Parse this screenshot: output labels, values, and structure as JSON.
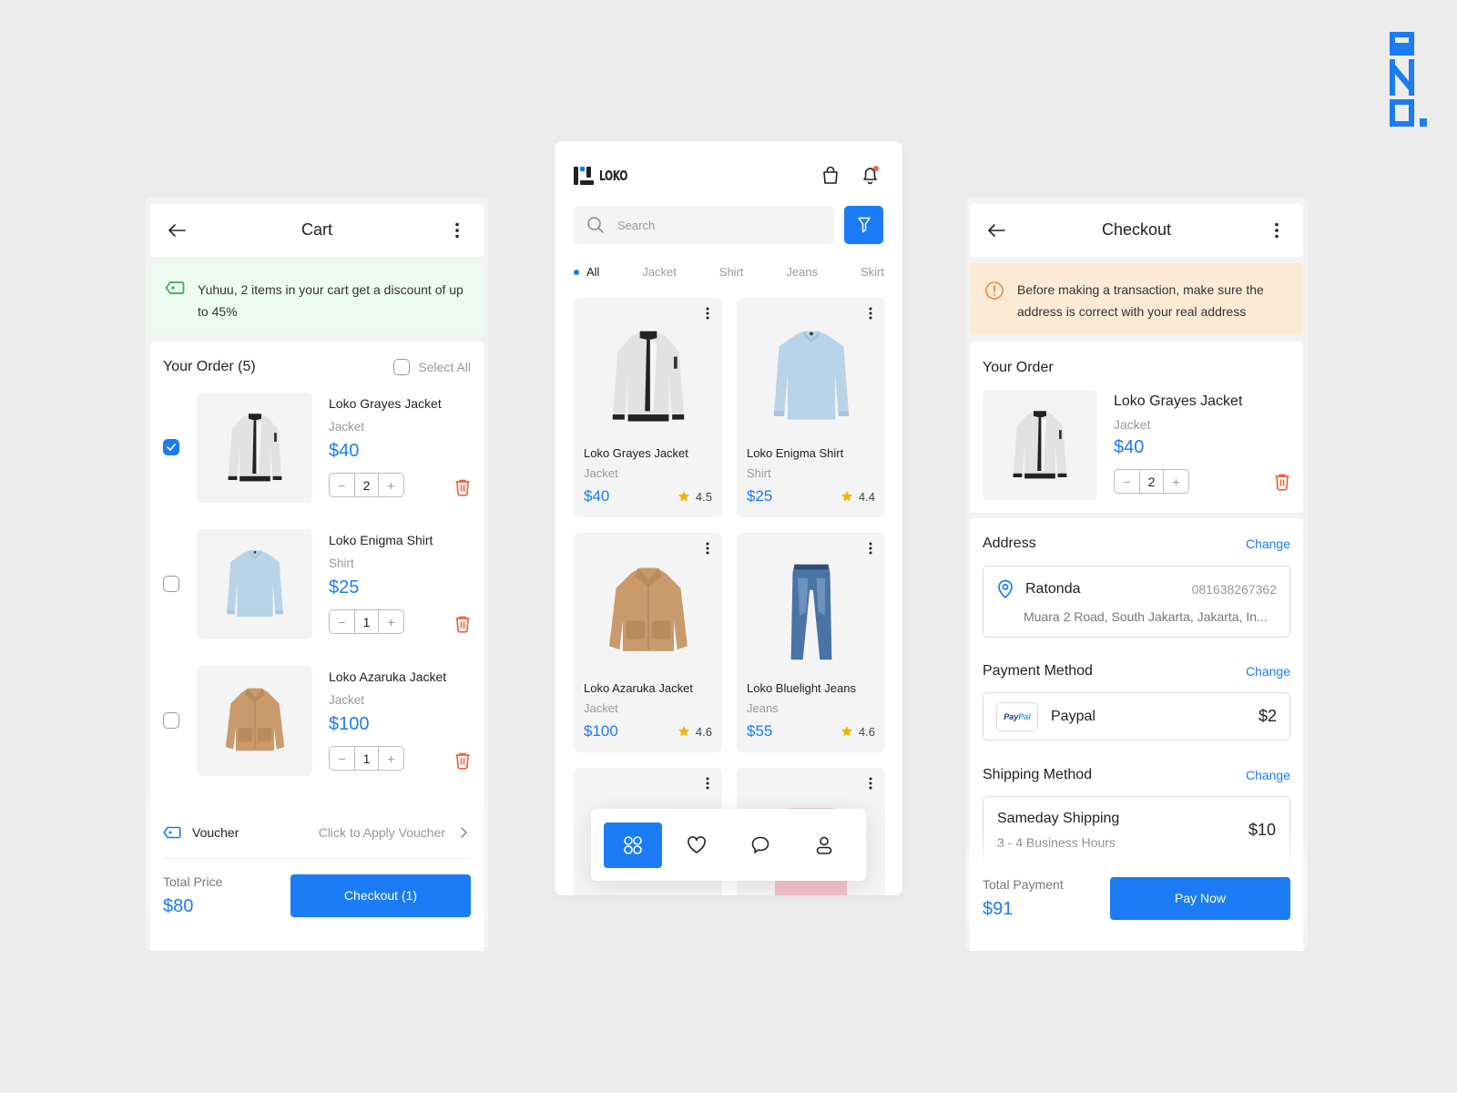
{
  "colors": {
    "accent": "#1b7cf5",
    "danger": "#f0623a",
    "success_bg": "#eefbf2",
    "success_icon": "#3aa65a",
    "warning_bg": "#fdebd6",
    "warning_icon": "#f08a3a",
    "rating_star": "#f5b400",
    "background": "#ececec"
  },
  "brand_mark": "ANO.",
  "cart": {
    "title": "Cart",
    "banner": "Yuhuu, 2 items in your cart get a discount of up to 45%",
    "order_title": "Your Order (5)",
    "select_all": "Select All",
    "items": [
      {
        "name": "Loko Grayes Jacket",
        "category": "Jacket",
        "price": "$40",
        "qty": "2",
        "selected": true,
        "image": "white-jacket"
      },
      {
        "name": "Loko Enigma Shirt",
        "category": "Shirt",
        "price": "$25",
        "qty": "1",
        "selected": false,
        "image": "blue-shirt"
      },
      {
        "name": "Loko Azaruka Jacket",
        "category": "Jacket",
        "price": "$100",
        "qty": "1",
        "selected": false,
        "image": "teddy-jacket"
      }
    ],
    "voucher_label": "Voucher",
    "voucher_hint": "Click to Apply Voucher",
    "total_label": "Total Price",
    "total_value": "$80",
    "checkout_button": "Checkout (1)"
  },
  "home": {
    "logo_text": "LOKO",
    "search_placeholder": "Search",
    "categories": [
      "All",
      "Jacket",
      "Shirt",
      "Jeans",
      "Skirt"
    ],
    "active_category": "All",
    "products": [
      {
        "name": "Loko Grayes Jacket",
        "category": "Jacket",
        "price": "$40",
        "rating": "4.5",
        "image": "white-jacket"
      },
      {
        "name": "Loko Enigma Shirt",
        "category": "Shirt",
        "price": "$25",
        "rating": "4.4",
        "image": "blue-shirt"
      },
      {
        "name": "Loko Azaruka Jacket",
        "category": "Jacket",
        "price": "$100",
        "rating": "4.6",
        "image": "teddy-jacket"
      },
      {
        "name": "Loko Bluelight Jeans",
        "category": "Jeans",
        "price": "$55",
        "rating": "4.6",
        "image": "jeans"
      }
    ],
    "nav": [
      "home",
      "favorites",
      "messages",
      "profile"
    ],
    "active_nav": "home"
  },
  "checkout": {
    "title": "Checkout",
    "banner": "Before making a transaction, make sure the address is correct with your real address",
    "order_title": "Your Order",
    "item": {
      "name": "Loko Grayes Jacket",
      "category": "Jacket",
      "price": "$40",
      "qty": "2"
    },
    "address_label": "Address",
    "change_label": "Change",
    "address": {
      "name": "Ratonda",
      "phone": "081638267362",
      "line": "Muara 2 Road, South Jakarta, Jakarta, In..."
    },
    "payment_label": "Payment Method",
    "payment": {
      "logo": "PayPal",
      "name": "Paypal",
      "fee": "$2"
    },
    "shipping_label": "Shipping Method",
    "shipping": {
      "name": "Sameday Shipping",
      "eta": "3 - 4 Business Hours",
      "price": "$10"
    },
    "total_label": "Total Payment",
    "total_value": "$91",
    "pay_button": "Pay Now"
  }
}
